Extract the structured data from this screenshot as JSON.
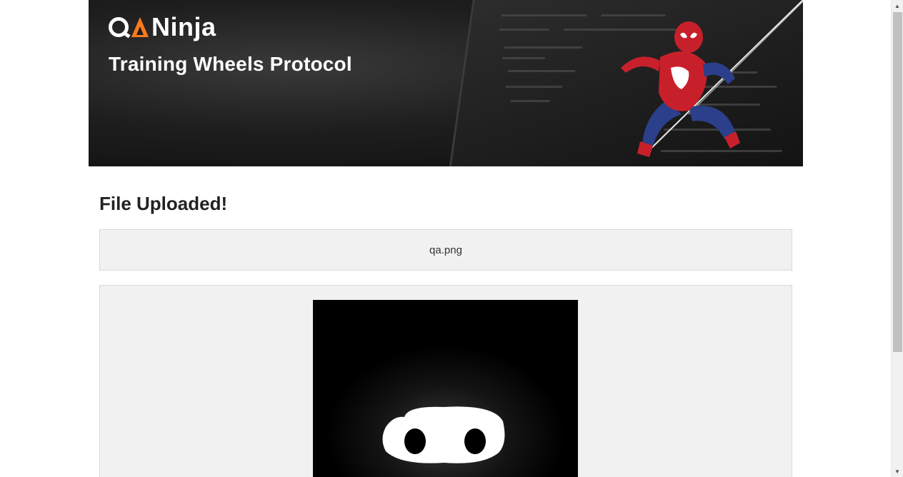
{
  "banner": {
    "logo_text": "Ninja",
    "logo_prefix": "QA",
    "subtitle": "Training Wheels Protocol",
    "accent_color": "#ff7a1a"
  },
  "page": {
    "title": "File Uploaded!",
    "filename": "qa.png"
  },
  "icons": {
    "scroll_up": "scroll-up-arrow-icon",
    "scroll_down": "scroll-down-arrow-icon"
  }
}
